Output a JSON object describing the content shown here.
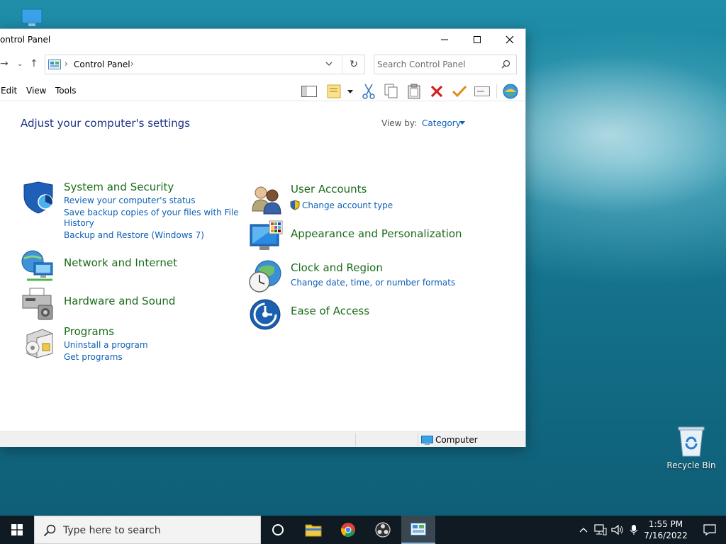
{
  "window": {
    "title": "ontrol Panel"
  },
  "address": {
    "crumb": "Control Panel",
    "search_placeholder": "Search Control Panel"
  },
  "menu": {
    "edit": "Edit",
    "view": "View",
    "tools": "Tools"
  },
  "content": {
    "heading": "Adjust your computer's settings",
    "view_by_label": "View by:",
    "view_by_value": "Category",
    "categories_left": [
      {
        "title": "System and Security",
        "icon": "shield-icon",
        "links": [
          "Review your computer's status",
          "Save backup copies of your files with File",
          "History",
          "Backup and Restore (Windows 7)"
        ]
      },
      {
        "title": "Network and Internet",
        "icon": "network-globe-icon",
        "links": []
      },
      {
        "title": "Hardware and Sound",
        "icon": "printer-icon",
        "links": []
      },
      {
        "title": "Programs",
        "icon": "programs-box-icon",
        "links": [
          "Uninstall a program",
          "Get programs"
        ]
      }
    ],
    "categories_right": [
      {
        "title": "User Accounts",
        "icon": "users-icon",
        "links": [
          "Change account type"
        ]
      },
      {
        "title": "Appearance and Personalization",
        "icon": "monitor-palette-icon",
        "links": []
      },
      {
        "title": "Clock and Region",
        "icon": "clock-globe-icon",
        "links": [
          "Change date, time, or number formats"
        ]
      },
      {
        "title": "Ease of Access",
        "icon": "ease-of-access-icon",
        "links": []
      }
    ]
  },
  "status": {
    "location": "Computer"
  },
  "desktop": {
    "recycle_bin": "Recycle Bin"
  },
  "taskbar": {
    "search_placeholder": "Type here to search",
    "time": "1:55 PM",
    "date": "7/16/2022"
  },
  "colors": {
    "heading": "#1e3287",
    "category_title": "#1a6c1a",
    "link": "#0d5fb6",
    "taskbar": "#0f1a22"
  }
}
